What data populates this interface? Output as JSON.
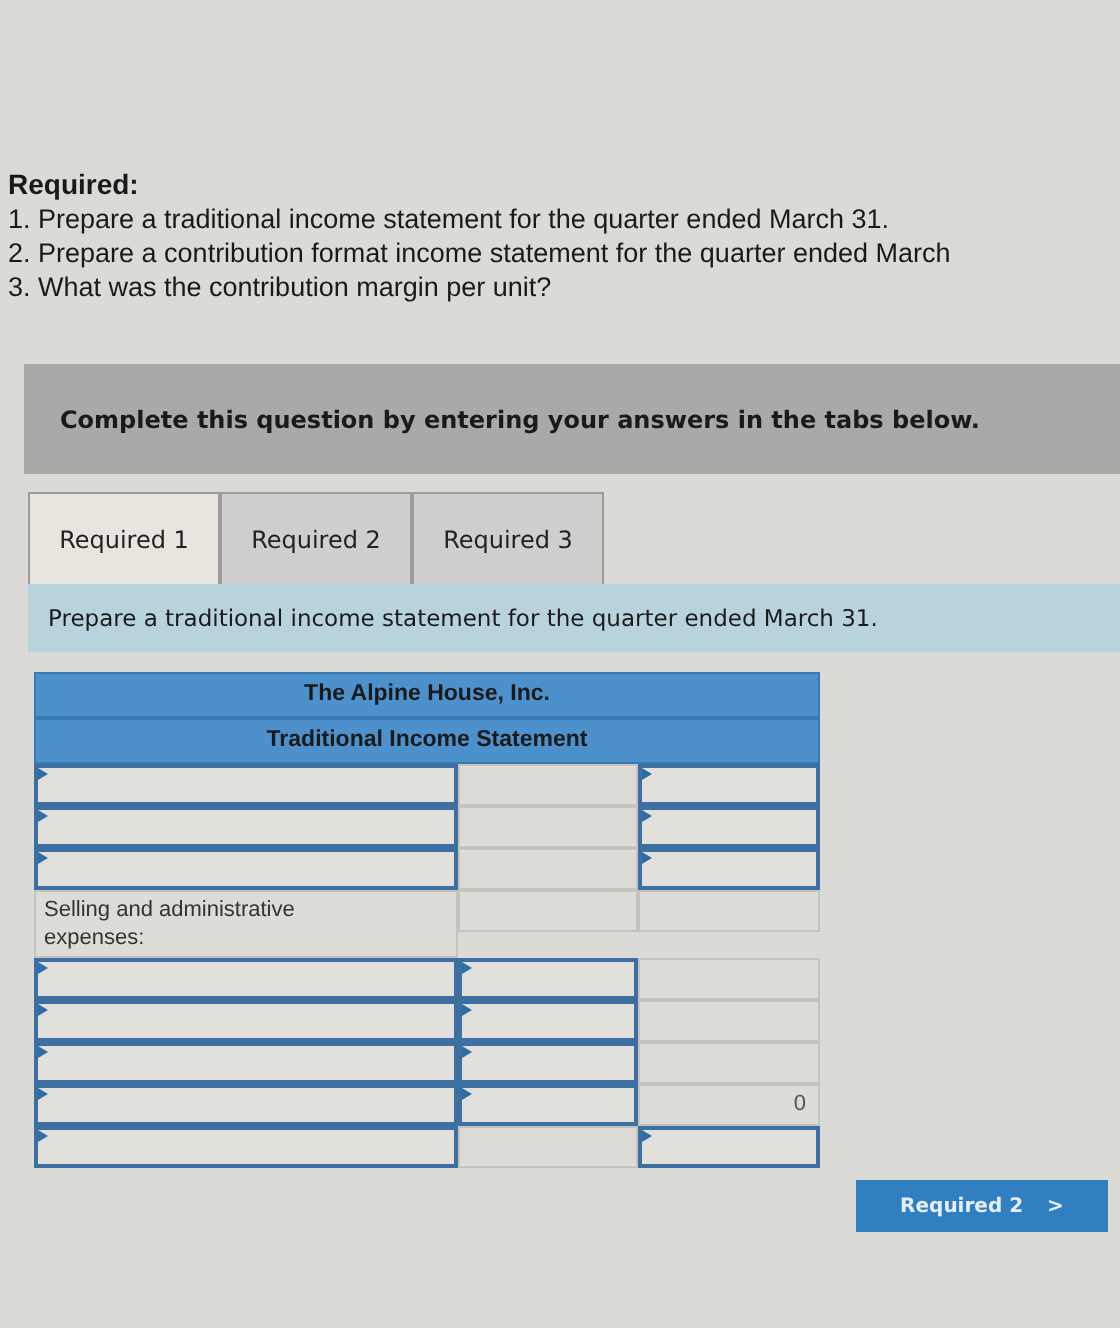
{
  "required": {
    "heading": "Required:",
    "items": [
      "1. Prepare a traditional income statement for the quarter ended March 31.",
      "2. Prepare a contribution format income statement for the quarter ended March",
      "3. What was the contribution margin per unit?"
    ]
  },
  "banner": "Complete this question by entering your answers in the tabs below.",
  "tabs": [
    {
      "label": "Required 1",
      "selected": true
    },
    {
      "label": "Required 2",
      "selected": false
    },
    {
      "label": "Required 3",
      "selected": false
    }
  ],
  "instruction": "Prepare a traditional income statement for the quarter ended March 31.",
  "statement": {
    "company": "The Alpine House, Inc.",
    "title": "Traditional Income Statement",
    "rows": [
      [
        {
          "kind": "input"
        },
        {
          "kind": "blank"
        },
        {
          "kind": "input"
        }
      ],
      [
        {
          "kind": "input"
        },
        {
          "kind": "blank"
        },
        {
          "kind": "input"
        }
      ],
      [
        {
          "kind": "input"
        },
        {
          "kind": "blank"
        },
        {
          "kind": "input"
        }
      ],
      [
        {
          "kind": "label",
          "text": "Selling and administrative expenses:"
        },
        {
          "kind": "blank"
        },
        {
          "kind": "blank"
        }
      ],
      [
        {
          "kind": "input"
        },
        {
          "kind": "input"
        },
        {
          "kind": "blank"
        }
      ],
      [
        {
          "kind": "input"
        },
        {
          "kind": "input"
        },
        {
          "kind": "blank"
        }
      ],
      [
        {
          "kind": "input"
        },
        {
          "kind": "input"
        },
        {
          "kind": "blank"
        }
      ],
      [
        {
          "kind": "input"
        },
        {
          "kind": "input"
        },
        {
          "kind": "value",
          "text": "0"
        }
      ],
      [
        {
          "kind": "input"
        },
        {
          "kind": "blank"
        },
        {
          "kind": "input"
        }
      ]
    ]
  },
  "next_button": {
    "label": "Required 2",
    "arrow": ">"
  }
}
